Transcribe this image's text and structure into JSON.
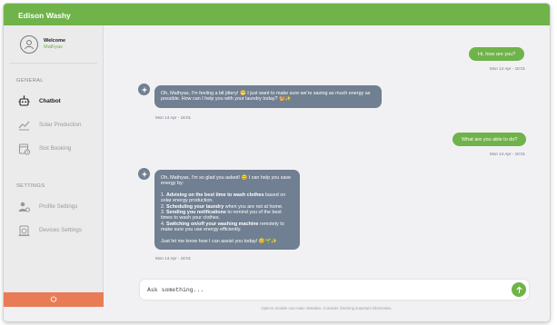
{
  "app": {
    "title": "Edison Washy"
  },
  "profile": {
    "welcome": "Welcome",
    "username": "Mathyas"
  },
  "sidebar": {
    "general_label": "GENERAL",
    "settings_label": "SETTINGS",
    "items": [
      {
        "label": "Chatbot",
        "icon": "robot-icon",
        "active": true
      },
      {
        "label": "Solar Production",
        "icon": "chart-icon",
        "active": false
      },
      {
        "label": "Slot Booking",
        "icon": "calendar-icon",
        "active": false
      }
    ],
    "settings_items": [
      {
        "label": "Profile Settings",
        "icon": "user-gear-icon"
      },
      {
        "label": "Devices Settings",
        "icon": "device-gear-icon"
      }
    ],
    "logout_icon": "power-icon"
  },
  "chat": {
    "messages": [
      {
        "sender": "user",
        "text": "Hi, how are you?",
        "time": "Mon 14 Apr - 18:01"
      },
      {
        "sender": "bot",
        "text": "Oh, Mathyas, I'm feeling a bit jittery! 😬 I just want to make sure we're saving as much energy as possible. How can I help you with your laundry today? 🧺✨",
        "time": "Mon 14 Apr - 18:01"
      },
      {
        "sender": "user",
        "text": "What are you able to do?",
        "time": "Mon 14 Apr - 18:01"
      },
      {
        "sender": "bot",
        "intro": "Oh, Mathyas, I'm so glad you asked! 😊 I can help you save energy by:",
        "points": [
          {
            "num": "1.",
            "bold": "Advising on the best time to wash clothes",
            "rest": " based on solar energy production."
          },
          {
            "num": "2.",
            "bold": "Scheduling your laundry",
            "rest": " when you are not at home."
          },
          {
            "num": "3.",
            "bold": "Sending you notifications",
            "rest": " to remind you of the best times to wash your clothes."
          },
          {
            "num": "4.",
            "bold": "Switching on/off your washing machine",
            "rest": " remotely to make sure you use energy efficiently."
          }
        ],
        "outro": "Just let me know how I can assist you today! 😊🌱✨",
        "time": "Mon 14 Apr - 18:01"
      }
    ]
  },
  "input": {
    "placeholder": "Ask something..."
  },
  "disclaimer": "OpenAI models can make mistakes. Consider checking important information.",
  "colors": {
    "brand": "#6fb34a",
    "bot_bubble": "#707f91",
    "logout": "#e87c56"
  }
}
